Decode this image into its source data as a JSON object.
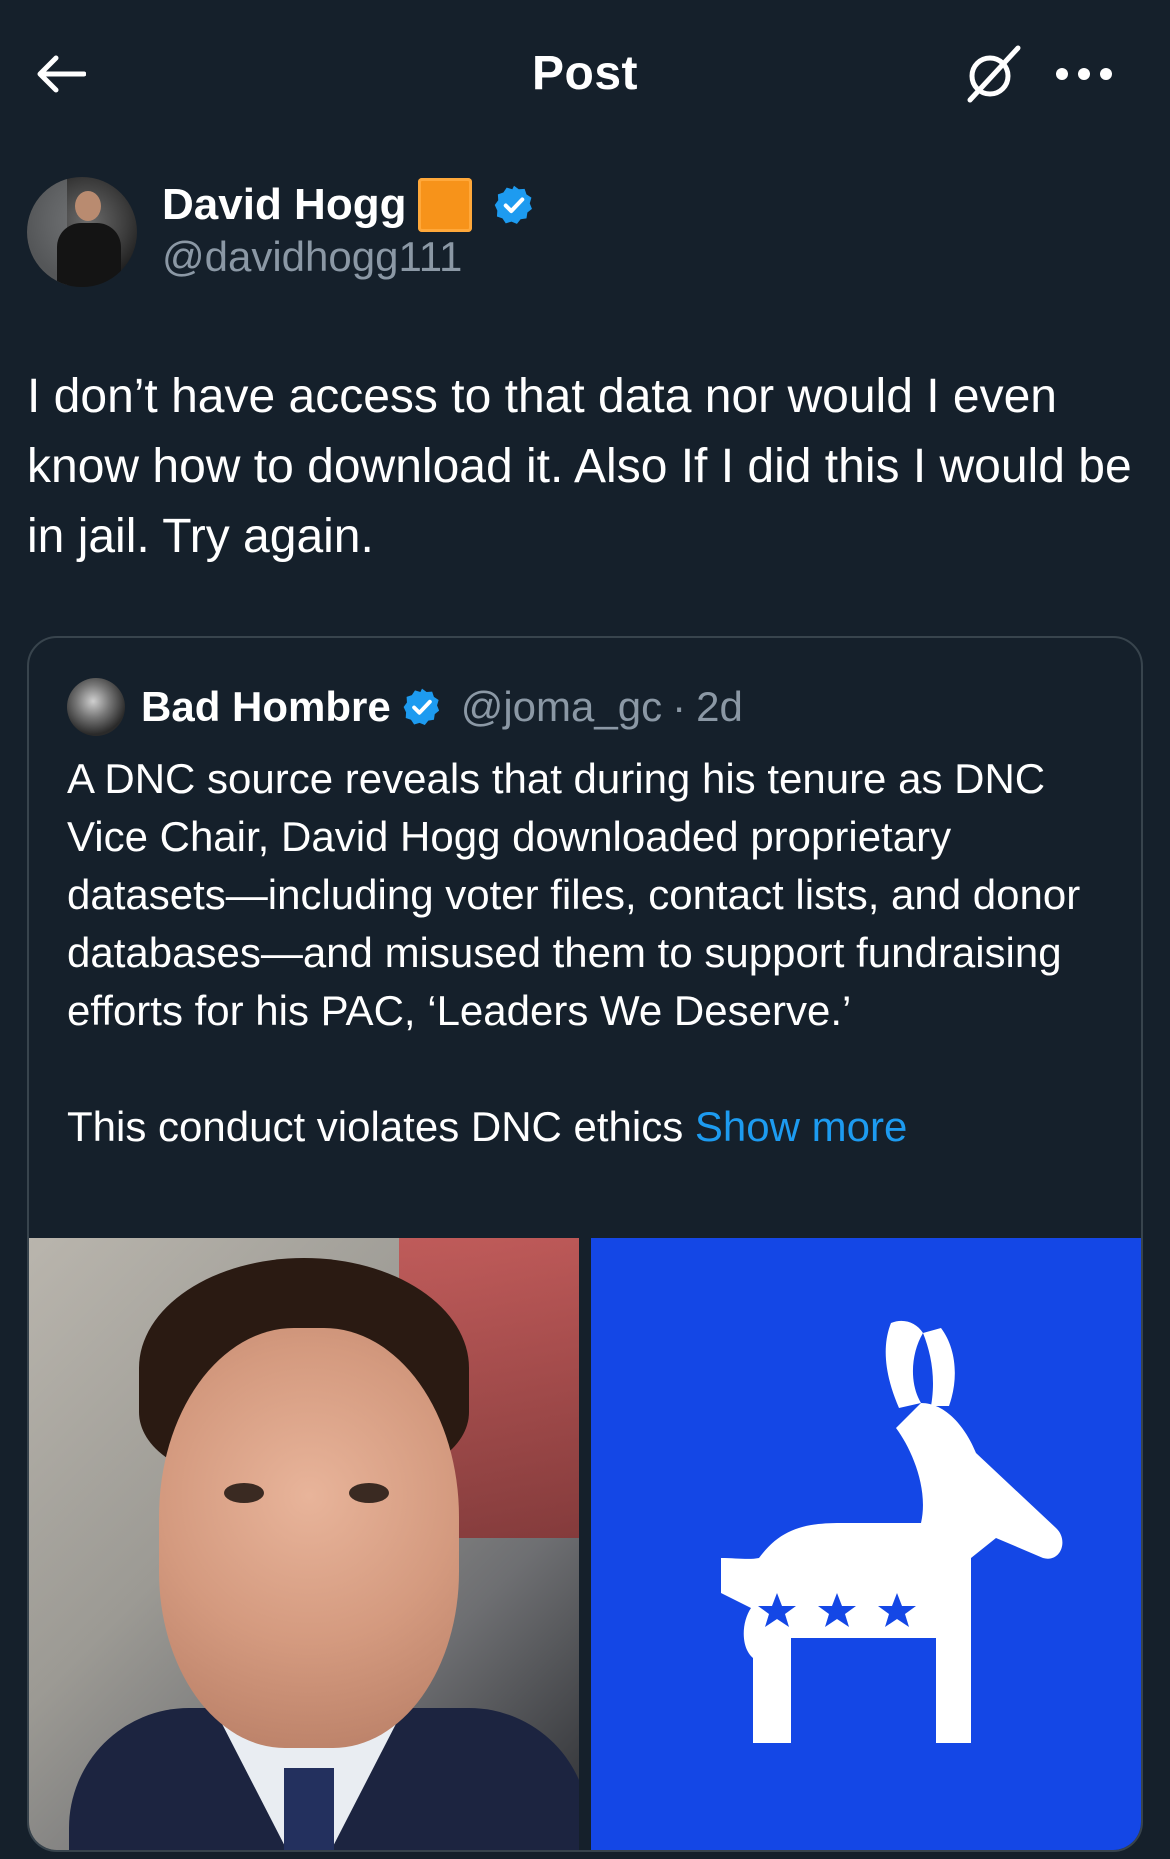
{
  "header": {
    "title": "Post"
  },
  "author": {
    "name": "David Hogg",
    "handle": "@davidhogg111"
  },
  "tweet": {
    "text": "I don’t have access to that data nor would I even know how to download it. Also If I did this I would be in jail. Try again."
  },
  "quote": {
    "name": "Bad Hombre",
    "handle": "@joma_gc",
    "separator": "·",
    "time": "2d",
    "paragraph1": "A DNC source reveals that during his tenure as DNC Vice Chair, David Hogg downloaded proprietary datasets—including voter files, contact lists, and donor databases—and misused them to support fundraising efforts for his PAC, ‘Leaders We Deserve.’",
    "paragraph2": "This conduct violates DNC ethics ",
    "show_more": "Show more"
  },
  "icons": {
    "back": "arrow-left-icon",
    "grok": "grok-icon",
    "more": "more-horizontal-icon",
    "verified": "verified-badge-icon"
  },
  "colors": {
    "background": "#15202b",
    "accent": "#1d9bf0",
    "secondary_text": "#8b98a5",
    "border": "#38444d",
    "dnc_blue": "#1447e6",
    "orange_square": "#f7931a"
  }
}
